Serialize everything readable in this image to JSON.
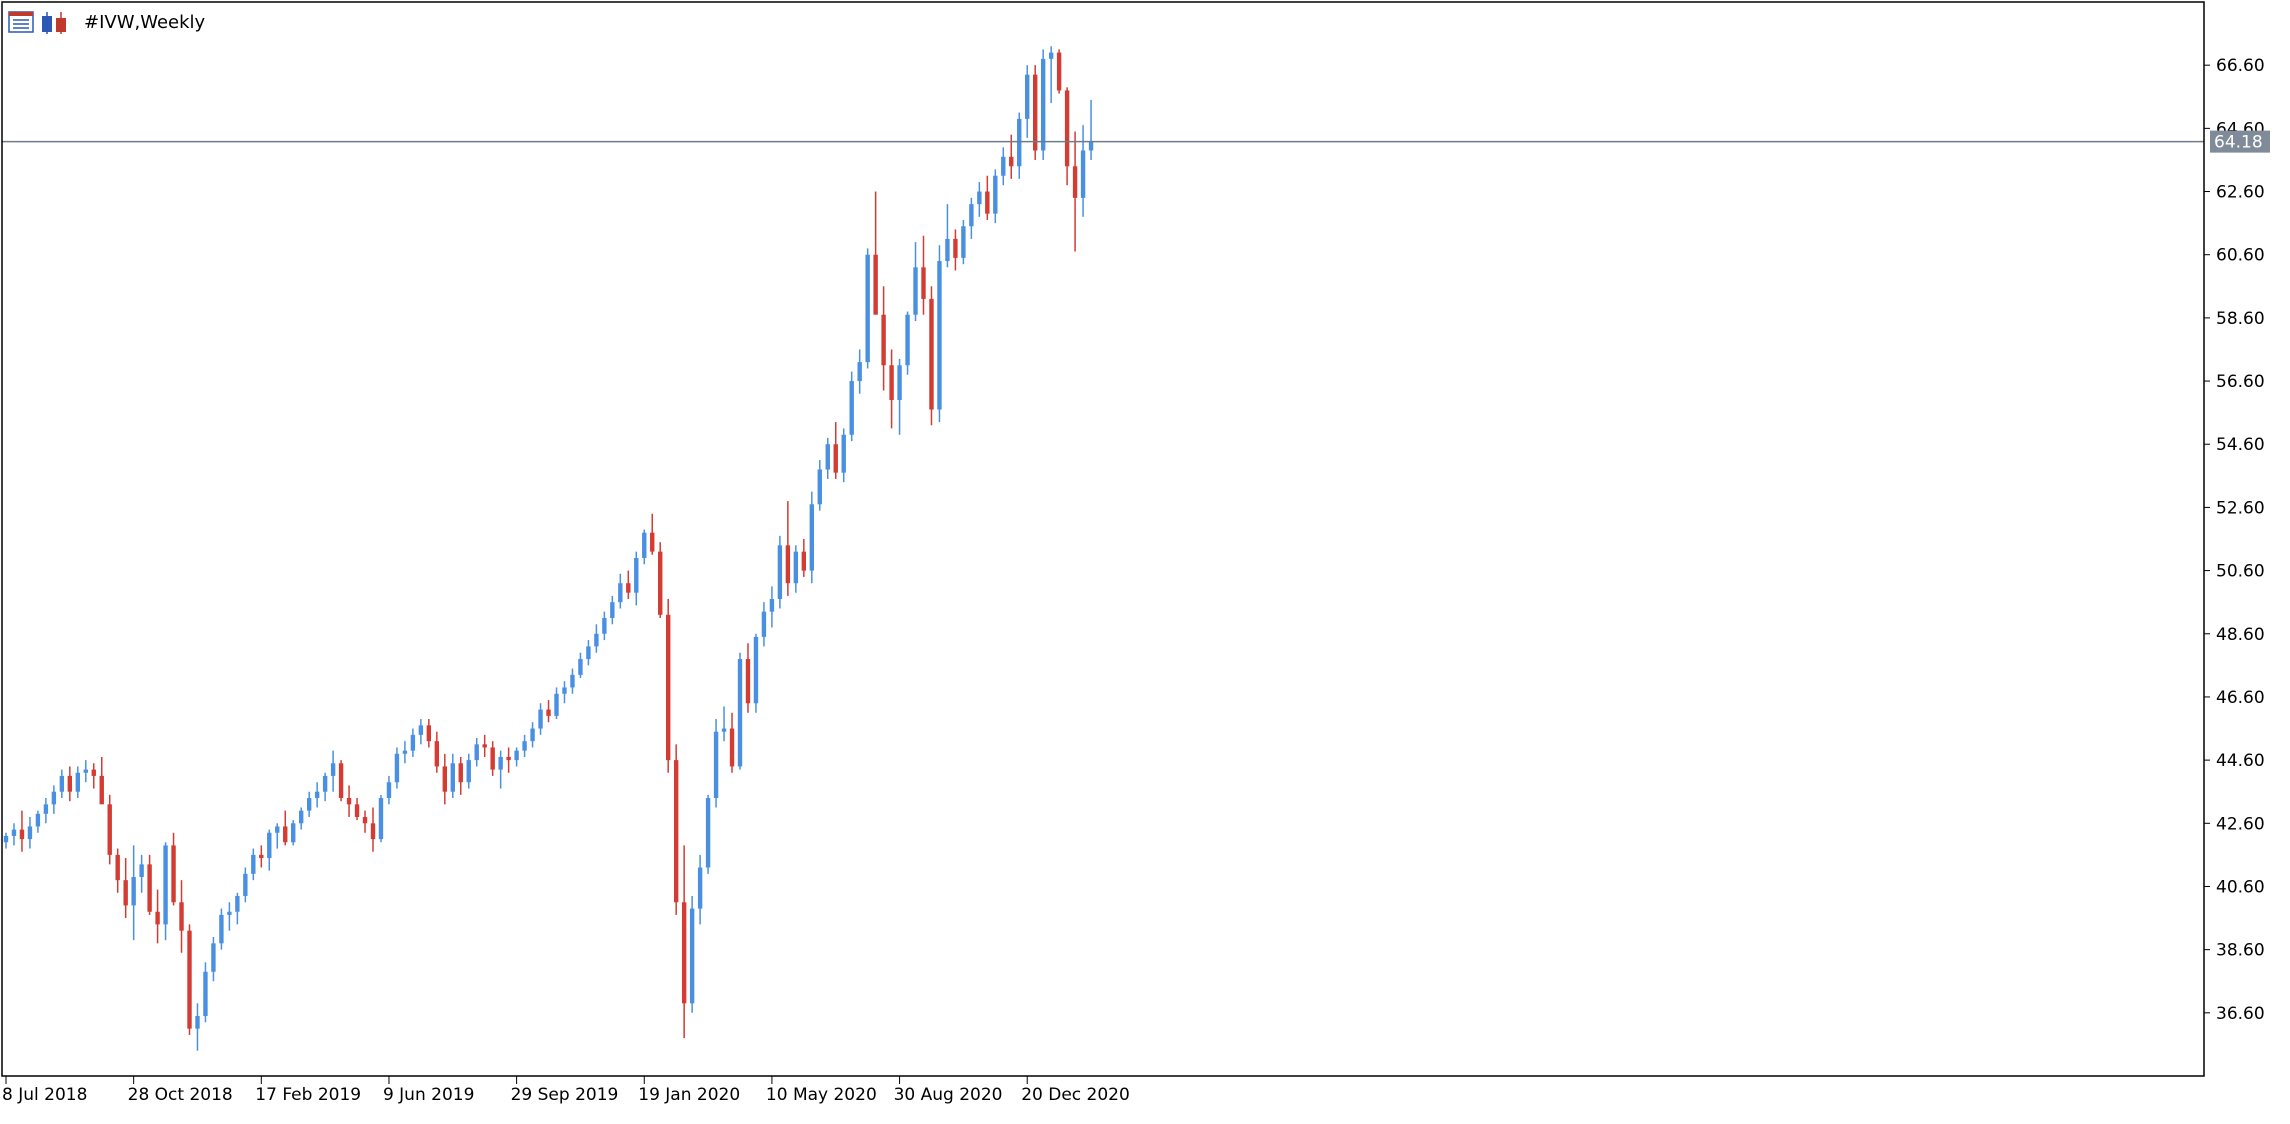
{
  "header": {
    "symbol_title": "#IVW,Weekly",
    "icons": [
      "chart-window-icon",
      "chart-type-icon"
    ]
  },
  "colors": {
    "bull": "#4a90e2",
    "bear": "#d43b32",
    "axis": "#000000",
    "price_line": "#6b7b8c",
    "price_label_bg": "#7f8b98",
    "price_label_text": "#ffffff"
  },
  "current_price": {
    "value": 64.18,
    "label": "64.18"
  },
  "chart_data": {
    "type": "candlestick",
    "title": "#IVW,Weekly",
    "ylim": [
      34.6,
      68.6
    ],
    "y_ticks": [
      36.6,
      38.6,
      40.6,
      42.6,
      44.6,
      46.6,
      48.6,
      50.6,
      52.6,
      54.6,
      56.6,
      58.6,
      60.6,
      62.6,
      64.6,
      66.6
    ],
    "y_tick_labels": [
      "36.60",
      "38.60",
      "40.60",
      "42.60",
      "44.60",
      "46.60",
      "48.60",
      "50.60",
      "52.60",
      "54.60",
      "56.60",
      "58.60",
      "60.60",
      "62.60",
      "64.60",
      "66.60"
    ],
    "x_tick_labels": [
      {
        "label": "8 Jul 2018",
        "bar": 0
      },
      {
        "label": "28 Oct 2018",
        "bar": 16
      },
      {
        "label": "17 Feb 2019",
        "bar": 32
      },
      {
        "label": "9 Jun 2019",
        "bar": 48
      },
      {
        "label": "29 Sep 2019",
        "bar": 64
      },
      {
        "label": "19 Jan 2020",
        "bar": 80
      },
      {
        "label": "10 May 2020",
        "bar": 96
      },
      {
        "label": "30 Aug 2020",
        "bar": 112
      },
      {
        "label": "20 Dec 2020",
        "bar": 128
      }
    ],
    "total_slots": 276,
    "bars": [
      [
        42.0,
        42.3,
        41.8,
        42.2
      ],
      [
        42.2,
        42.6,
        41.9,
        42.4
      ],
      [
        42.4,
        43.0,
        41.7,
        42.1
      ],
      [
        42.1,
        42.8,
        41.8,
        42.5
      ],
      [
        42.5,
        43.0,
        42.3,
        42.9
      ],
      [
        42.9,
        43.4,
        42.6,
        43.2
      ],
      [
        43.2,
        43.8,
        42.9,
        43.6
      ],
      [
        43.6,
        44.3,
        43.4,
        44.1
      ],
      [
        44.1,
        44.4,
        43.3,
        43.6
      ],
      [
        43.6,
        44.4,
        43.4,
        44.2
      ],
      [
        44.2,
        44.6,
        43.9,
        44.3
      ],
      [
        44.3,
        44.5,
        43.7,
        44.1
      ],
      [
        44.1,
        44.7,
        43.6,
        43.2
      ],
      [
        43.2,
        43.5,
        41.3,
        41.6
      ],
      [
        41.6,
        41.8,
        40.4,
        40.8
      ],
      [
        40.8,
        41.5,
        39.6,
        40.0
      ],
      [
        40.0,
        41.9,
        38.9,
        40.9
      ],
      [
        40.9,
        41.6,
        40.4,
        41.3
      ],
      [
        41.3,
        41.6,
        39.7,
        39.8
      ],
      [
        39.8,
        40.5,
        38.8,
        39.4
      ],
      [
        39.4,
        42.0,
        38.9,
        41.9
      ],
      [
        41.9,
        42.3,
        40.0,
        40.1
      ],
      [
        40.1,
        40.8,
        38.5,
        39.2
      ],
      [
        39.2,
        39.4,
        35.9,
        36.1
      ],
      [
        36.1,
        36.9,
        35.4,
        36.5
      ],
      [
        36.5,
        38.2,
        36.3,
        37.9
      ],
      [
        37.9,
        39.0,
        37.6,
        38.8
      ],
      [
        38.8,
        39.9,
        38.6,
        39.7
      ],
      [
        39.7,
        40.1,
        39.2,
        39.8
      ],
      [
        39.8,
        40.4,
        39.4,
        40.3
      ],
      [
        40.3,
        41.2,
        40.1,
        41.0
      ],
      [
        41.0,
        41.8,
        40.8,
        41.6
      ],
      [
        41.6,
        41.9,
        41.2,
        41.5
      ],
      [
        41.5,
        42.4,
        41.1,
        42.3
      ],
      [
        42.3,
        42.6,
        41.8,
        42.5
      ],
      [
        42.5,
        43.0,
        41.9,
        42.0
      ],
      [
        42.0,
        42.7,
        41.9,
        42.6
      ],
      [
        42.6,
        43.1,
        42.4,
        43.0
      ],
      [
        43.0,
        43.6,
        42.8,
        43.4
      ],
      [
        43.4,
        43.9,
        43.1,
        43.6
      ],
      [
        43.6,
        44.2,
        43.3,
        44.1
      ],
      [
        44.1,
        44.9,
        43.6,
        44.5
      ],
      [
        44.5,
        44.6,
        43.3,
        43.4
      ],
      [
        43.4,
        43.8,
        42.8,
        43.2
      ],
      [
        43.2,
        43.4,
        42.7,
        42.8
      ],
      [
        42.8,
        43.0,
        42.3,
        42.6
      ],
      [
        42.6,
        43.1,
        41.7,
        42.1
      ],
      [
        42.1,
        43.5,
        42.0,
        43.4
      ],
      [
        43.4,
        44.1,
        43.2,
        43.9
      ],
      [
        43.9,
        45.0,
        43.7,
        44.8
      ],
      [
        44.8,
        45.2,
        44.5,
        44.9
      ],
      [
        44.9,
        45.6,
        44.7,
        45.4
      ],
      [
        45.4,
        45.9,
        45.1,
        45.7
      ],
      [
        45.7,
        45.9,
        45.0,
        45.2
      ],
      [
        45.2,
        45.5,
        44.2,
        44.4
      ],
      [
        44.4,
        44.8,
        43.2,
        43.6
      ],
      [
        43.6,
        44.8,
        43.4,
        44.5
      ],
      [
        44.5,
        44.7,
        43.5,
        43.9
      ],
      [
        43.9,
        44.8,
        43.7,
        44.6
      ],
      [
        44.6,
        45.3,
        44.4,
        45.1
      ],
      [
        45.1,
        45.4,
        44.7,
        45.0
      ],
      [
        45.0,
        45.2,
        44.1,
        44.3
      ],
      [
        44.3,
        44.9,
        43.7,
        44.7
      ],
      [
        44.7,
        45.0,
        44.2,
        44.6
      ],
      [
        44.6,
        45.0,
        44.4,
        44.9
      ],
      [
        44.9,
        45.4,
        44.7,
        45.2
      ],
      [
        45.2,
        45.8,
        45.0,
        45.6
      ],
      [
        45.6,
        46.4,
        45.4,
        46.2
      ],
      [
        46.2,
        46.5,
        45.8,
        46.0
      ],
      [
        46.0,
        46.9,
        45.9,
        46.7
      ],
      [
        46.7,
        47.1,
        46.4,
        46.9
      ],
      [
        46.9,
        47.5,
        46.7,
        47.3
      ],
      [
        47.3,
        48.0,
        47.2,
        47.8
      ],
      [
        47.8,
        48.4,
        47.6,
        48.2
      ],
      [
        48.2,
        48.9,
        48.0,
        48.6
      ],
      [
        48.6,
        49.3,
        48.4,
        49.1
      ],
      [
        49.1,
        49.8,
        48.9,
        49.6
      ],
      [
        49.6,
        50.5,
        49.4,
        50.2
      ],
      [
        50.2,
        50.6,
        49.7,
        49.9
      ],
      [
        49.9,
        51.2,
        49.5,
        51.0
      ],
      [
        51.0,
        51.9,
        50.8,
        51.8
      ],
      [
        51.8,
        52.4,
        51.1,
        51.2
      ],
      [
        51.2,
        51.5,
        49.1,
        49.2
      ],
      [
        49.2,
        49.7,
        44.2,
        44.6
      ],
      [
        44.6,
        45.1,
        39.7,
        40.1
      ],
      [
        40.1,
        41.9,
        35.8,
        36.9
      ],
      [
        36.9,
        40.3,
        36.6,
        39.9
      ],
      [
        39.9,
        41.6,
        39.4,
        41.2
      ],
      [
        41.2,
        43.5,
        41.0,
        43.4
      ],
      [
        43.4,
        45.9,
        43.1,
        45.5
      ],
      [
        45.5,
        46.3,
        45.2,
        45.6
      ],
      [
        45.6,
        46.1,
        44.2,
        44.4
      ],
      [
        44.4,
        48.0,
        44.3,
        47.8
      ],
      [
        47.8,
        48.3,
        46.1,
        46.4
      ],
      [
        46.4,
        48.6,
        46.1,
        48.5
      ],
      [
        48.5,
        49.6,
        48.2,
        49.3
      ],
      [
        49.3,
        50.1,
        48.8,
        49.7
      ],
      [
        49.7,
        51.7,
        49.4,
        51.4
      ],
      [
        51.4,
        52.8,
        49.8,
        50.2
      ],
      [
        50.2,
        51.4,
        49.9,
        51.2
      ],
      [
        51.2,
        51.6,
        50.4,
        50.6
      ],
      [
        50.6,
        53.1,
        50.2,
        52.7
      ],
      [
        52.7,
        54.1,
        52.5,
        53.8
      ],
      [
        53.8,
        54.8,
        53.5,
        54.6
      ],
      [
        54.6,
        55.3,
        53.5,
        53.7
      ],
      [
        53.7,
        55.1,
        53.4,
        54.9
      ],
      [
        54.9,
        56.9,
        54.7,
        56.6
      ],
      [
        56.6,
        57.6,
        56.2,
        57.2
      ],
      [
        57.2,
        60.8,
        57.0,
        60.6
      ],
      [
        60.6,
        62.6,
        59.0,
        58.7
      ],
      [
        58.7,
        59.6,
        56.3,
        57.1
      ],
      [
        57.1,
        57.6,
        55.1,
        56.0
      ],
      [
        56.0,
        57.3,
        54.9,
        57.1
      ],
      [
        57.1,
        58.8,
        56.8,
        58.7
      ],
      [
        58.7,
        61.0,
        58.5,
        60.2
      ],
      [
        60.2,
        61.2,
        58.7,
        59.2
      ],
      [
        59.2,
        59.6,
        55.2,
        55.7
      ],
      [
        55.7,
        60.9,
        55.3,
        60.4
      ],
      [
        60.4,
        62.2,
        60.2,
        61.1
      ],
      [
        61.1,
        61.4,
        60.1,
        60.5
      ],
      [
        60.5,
        61.7,
        60.3,
        61.5
      ],
      [
        61.5,
        62.4,
        61.1,
        62.2
      ],
      [
        62.2,
        62.9,
        61.8,
        62.6
      ],
      [
        62.6,
        63.1,
        61.7,
        61.9
      ],
      [
        61.9,
        63.3,
        61.6,
        63.1
      ],
      [
        63.1,
        64.0,
        62.8,
        63.7
      ],
      [
        63.7,
        64.4,
        63.0,
        63.4
      ],
      [
        63.4,
        65.1,
        63.0,
        64.9
      ],
      [
        64.9,
        66.6,
        64.3,
        66.3
      ],
      [
        66.3,
        66.6,
        63.6,
        63.9
      ],
      [
        63.9,
        67.1,
        63.6,
        66.8
      ],
      [
        66.8,
        67.2,
        65.4,
        67.0
      ],
      [
        67.0,
        67.1,
        65.7,
        65.8
      ],
      [
        65.8,
        65.9,
        62.8,
        63.4
      ],
      [
        63.4,
        64.5,
        60.7,
        62.4
      ],
      [
        62.4,
        64.7,
        61.8,
        63.9
      ],
      [
        63.9,
        65.5,
        63.6,
        64.18
      ]
    ]
  }
}
